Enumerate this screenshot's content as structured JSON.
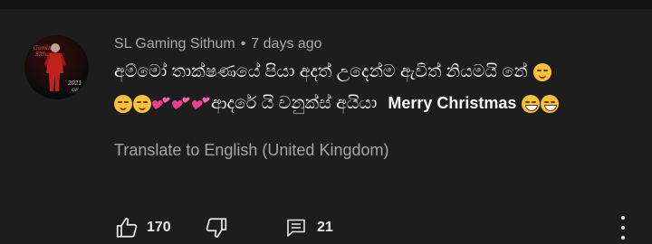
{
  "comment": {
    "author": "SL Gaming Sithum",
    "separator": "•",
    "timestamp": "7 days ago",
    "avatar_icon": "gamer-avatar",
    "line1_text": "අම්මෝ තාක්ෂණයේ පියා අදත් උදෙන්ම ඇවිත් නියමයි නේ",
    "line2_text": "ආදරේ යි චනුක්ස් අයියා",
    "line2_english": "Merry Christmas",
    "emojis": [
      "relieved-face",
      "relieved-face",
      "relieved-face",
      "two-hearts",
      "two-hearts",
      "two-hearts",
      "grinning-face",
      "grinning-face"
    ],
    "translate_link": "Translate to English (United Kingdom)"
  },
  "actions": {
    "like_count": "170",
    "reply_count": "21",
    "like_icon": "thumbs-up-icon",
    "dislike_icon": "thumbs-down-icon",
    "reply_icon": "comment-icon",
    "more_icon": "more-vert-icon"
  },
  "colors": {
    "background": "#1d1d1d",
    "text_primary": "#f1f1f1",
    "text_secondary": "#aaaaaa",
    "emoji_yellow": "#f7c23a",
    "heart_pink": "#e8418b"
  }
}
